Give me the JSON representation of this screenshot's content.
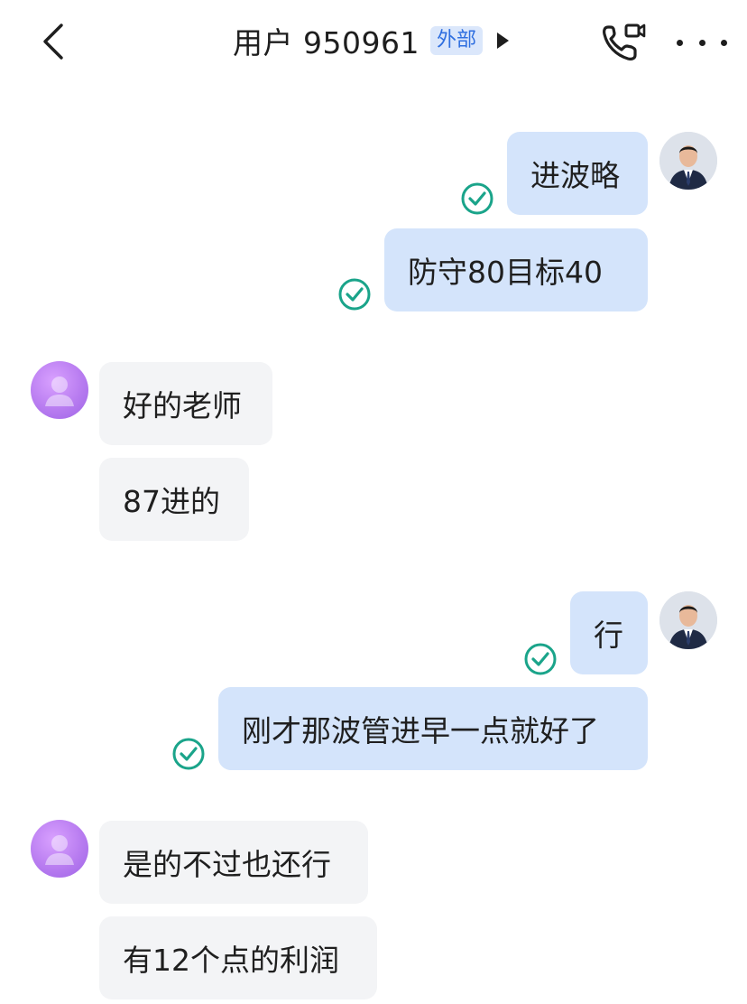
{
  "header": {
    "title": "用户 950961",
    "badge": "外部",
    "back_icon": "chevron-left-icon",
    "call_icon": "phone-video-icon",
    "more_icon": "more-dots-icon"
  },
  "messages": [
    {
      "from": "me",
      "text": "进波略"
    },
    {
      "from": "me",
      "text": "防守80目标40"
    },
    {
      "from": "other",
      "text": "好的老师"
    },
    {
      "from": "other",
      "text": "87进的"
    },
    {
      "from": "me",
      "text": "行"
    },
    {
      "from": "me",
      "text": "刚才那波管进早一点就好了"
    },
    {
      "from": "other",
      "text": "是的不过也还行"
    },
    {
      "from": "other",
      "text": "有12个点的利润"
    }
  ],
  "colors": {
    "outgoing_bubble": "#d4e4fb",
    "incoming_bubble": "#f3f4f6",
    "read_check": "#1aa48a",
    "badge_bg": "#dbe7fb",
    "badge_text": "#2f6fe0"
  }
}
